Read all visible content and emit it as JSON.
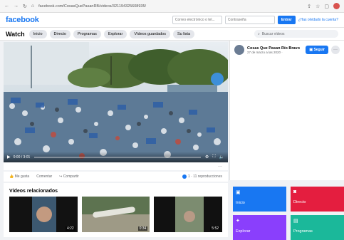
{
  "browser": {
    "url": "facebook.com/CosasQuePasanRB/videos/321194325608935/"
  },
  "header": {
    "logo": "facebook",
    "email_placeholder": "Correo electrónico o tel...",
    "password_placeholder": "Contraseña",
    "login_label": "Entrar",
    "forgot_label": "¿Has olvidado la cuenta?"
  },
  "watch": {
    "title": "Watch",
    "tabs": [
      "Inicio",
      "Directo",
      "Programas",
      "Explorar",
      "Vídeos guardados",
      "Su lista"
    ],
    "search_placeholder": "Buscar vídeos"
  },
  "video": {
    "time": "0:00 / 3:01",
    "progress": 0.0,
    "more": "···"
  },
  "actions": {
    "like": "Me gusta",
    "comment": "Comentar",
    "share": "Compartir",
    "views": "1 · 11 reproducciones"
  },
  "page": {
    "name": "Cosas Que Pasan Río Bravo",
    "date": "27 de marzo a las 2020 · ",
    "follow": "Seguir",
    "more": "···"
  },
  "related": {
    "title": "Vídeos relacionados",
    "items": [
      {
        "duration": "4:22"
      },
      {
        "duration": "0:34"
      },
      {
        "duration": "5:52"
      }
    ]
  },
  "tiles": [
    {
      "label": "Inicio",
      "color": "#1877f2"
    },
    {
      "label": "Directo",
      "color": "#e41e3f"
    },
    {
      "label": "Explorar",
      "color": "#8a3ffc"
    },
    {
      "label": "Programas",
      "color": "#1bb89a"
    }
  ]
}
